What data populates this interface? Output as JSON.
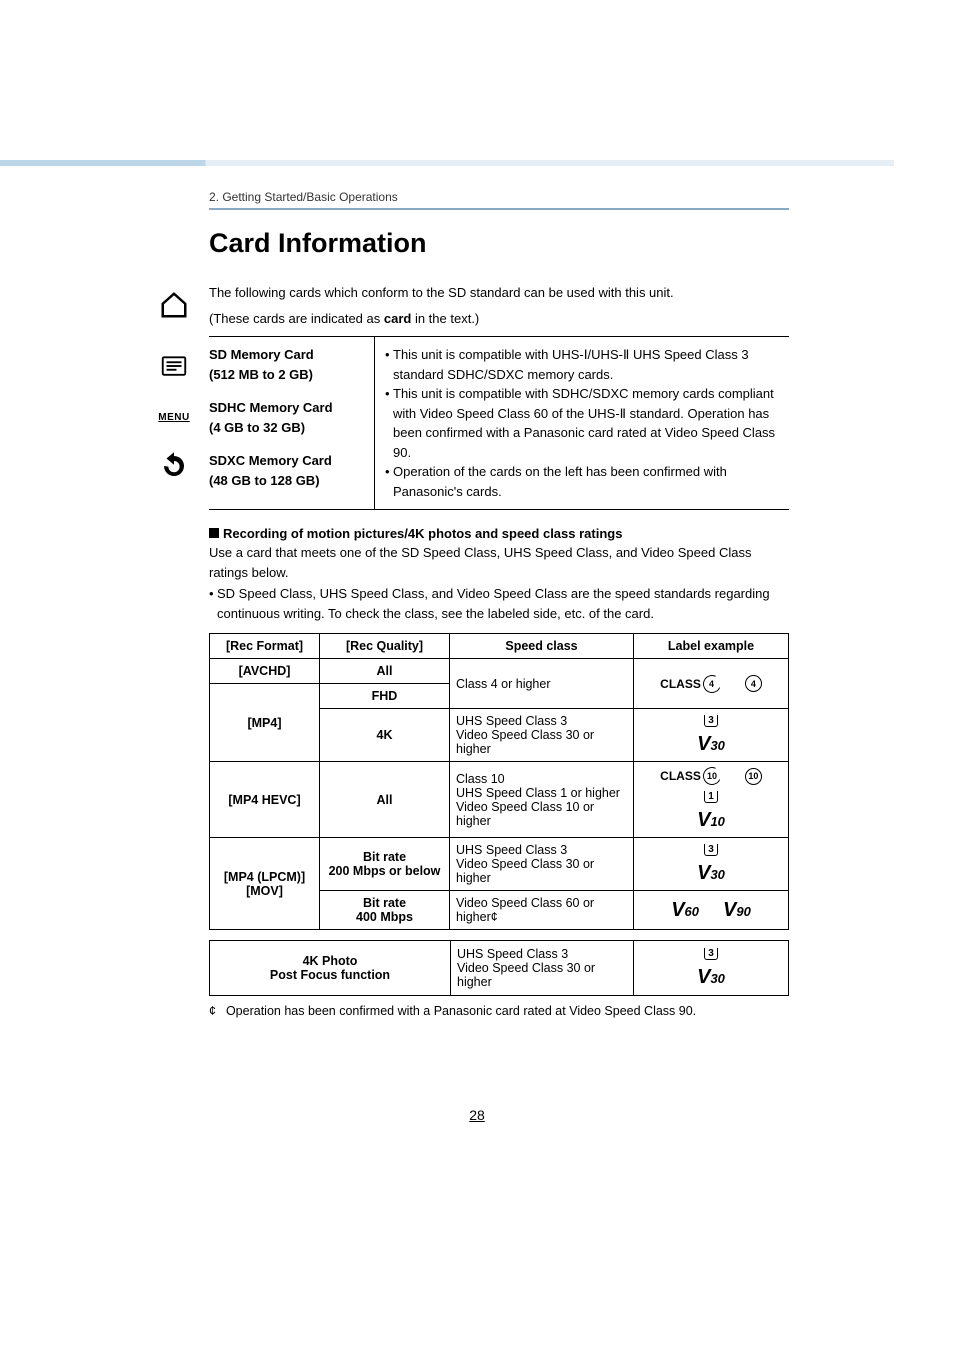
{
  "breadcrumb": "2. Getting Started/Basic Operations",
  "title": "Card Information",
  "intro1": "The following cards which conform to the SD standard can be used with this unit.",
  "intro2_pre": "(These cards are indicated as ",
  "intro2_bold": "card",
  "intro2_post": " in the text.)",
  "card_types": {
    "sd_title": "SD Memory Card",
    "sd_cap": "(512 MB to 2 GB)",
    "sdhc_title": "SDHC Memory Card",
    "sdhc_cap": "(4 GB to 32 GB)",
    "sdxc_title": "SDXC Memory Card",
    "sdxc_cap": "(48 GB to 128 GB)",
    "bullet1": "This unit is compatible with UHS-Ⅰ/UHS-Ⅱ UHS Speed Class 3 standard SDHC/SDXC memory cards.",
    "bullet2": "This unit is compatible with SDHC/SDXC memory cards compliant with Video Speed Class 60 of the UHS-Ⅱ standard. Operation has been confirmed with a Panasonic card rated at Video Speed Class 90.",
    "bullet3": "Operation of the cards on the left has been confirmed with Panasonic's cards."
  },
  "subheading": "Recording of motion pictures/4K photos and speed class ratings",
  "sub_para": "Use a card that meets one of the SD Speed Class, UHS Speed Class, and Video Speed Class ratings below.",
  "sub_note": "SD Speed Class, UHS Speed Class, and Video Speed Class are the speed standards regarding continuous writing. To check the class, see the labeled side, etc. of the card.",
  "headers": {
    "rec_format": "[Rec Format]",
    "rec_quality": "[Rec Quality]",
    "speed_class": "Speed class",
    "label_example": "Label example"
  },
  "chart_data": {
    "type": "table",
    "rows": [
      {
        "format": "[AVCHD]",
        "quality": "All",
        "speed": "Class 4 or higher",
        "labels": [
          "CLASS(4)",
          "(4)"
        ]
      },
      {
        "format": "[MP4]",
        "quality": "FHD",
        "speed": "Class 4 or higher",
        "labels": [
          "CLASS(4)",
          "(4)"
        ]
      },
      {
        "format": "[MP4]",
        "quality": "4K",
        "speed": "UHS Speed Class 3 / Video Speed Class 30 or higher",
        "labels": [
          "U3",
          "V30"
        ]
      },
      {
        "format": "[MP4 HEVC]",
        "quality": "All",
        "speed": "Class 10 / UHS Speed Class 1 or higher / Video Speed Class 10 or higher",
        "labels": [
          "CLASS(10)",
          "(10)",
          "U1",
          "V10"
        ]
      },
      {
        "format": "[MP4 (LPCM)] [MOV]",
        "quality": "Bit rate 200 Mbps or below",
        "speed": "UHS Speed Class 3 / Video Speed Class 30 or higher",
        "labels": [
          "U3",
          "V30"
        ]
      },
      {
        "format": "[MP4 (LPCM)] [MOV]",
        "quality": "Bit rate 400 Mbps",
        "speed": "Video Speed Class 60 or higher*",
        "labels": [
          "V60",
          "V90"
        ]
      },
      {
        "format": "4K Photo / Post Focus function",
        "quality": "",
        "speed": "UHS Speed Class 3 / Video Speed Class 30 or higher",
        "labels": [
          "U3",
          "V30"
        ]
      }
    ]
  },
  "rows": {
    "avchd": "[AVCHD]",
    "all": "All",
    "fhd": "FHD",
    "mp4": "[MP4]",
    "k4": "4K",
    "class4": "Class 4 or higher",
    "uhs3_l1": "UHS Speed Class 3",
    "uhs3_l2": "Video Speed Class 30 or higher",
    "mp4hevc": "[MP4 HEVC]",
    "hevc_l1": "Class 10",
    "hevc_l2": "UHS Speed Class 1 or higher",
    "hevc_l3": "Video Speed Class 10 or higher",
    "mp4lpcm_l1": "[MP4 (LPCM)]",
    "mp4lpcm_l2": "[MOV]",
    "br200_l1": "Bit rate",
    "br200_l2": "200 Mbps or below",
    "br400_l1": "Bit rate",
    "br400_l2": "400 Mbps",
    "v60_l1": "Video Speed Class 60 or higher",
    "asterisk": "¢",
    "photo4k": "4K Photo",
    "postfocus": "Post Focus function"
  },
  "labels": {
    "class_word": "CLASS",
    "n4": "4",
    "n10": "10",
    "n1": "1",
    "n3": "3",
    "v30": "30",
    "v10": "10",
    "v60": "60",
    "v90": "90",
    "V": "V"
  },
  "footnote_mark": "¢",
  "footnote": "Operation has been confirmed with a Panasonic card rated at Video Speed Class 90.",
  "page": "28",
  "sidebar_menu": "MENU"
}
